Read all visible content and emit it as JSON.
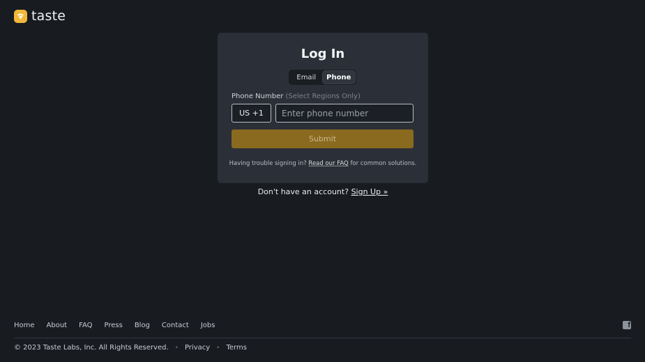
{
  "brand": {
    "name": "taste",
    "accent": "#f0b83a"
  },
  "login": {
    "title": "Log In",
    "tabs": [
      {
        "label": "Email",
        "active": false
      },
      {
        "label": "Phone",
        "active": true
      }
    ],
    "phone_label": "Phone Number",
    "phone_label_note": "(Select Regions Only)",
    "country_code": "US +1",
    "phone_placeholder": "Enter phone number",
    "submit_label": "Submit",
    "help_prefix": "Having trouble signing in?",
    "help_link": "Read our FAQ",
    "help_suffix": "for common solutions."
  },
  "signup": {
    "prompt": "Don't have an account?",
    "link": "Sign Up »"
  },
  "footer": {
    "nav": [
      "Home",
      "About",
      "FAQ",
      "Press",
      "Blog",
      "Contact",
      "Jobs"
    ],
    "copyright": "© 2023 Taste Labs, Inc. All Rights Reserved.",
    "links": [
      "Privacy",
      "Terms"
    ],
    "social_icon": "facebook-icon"
  }
}
